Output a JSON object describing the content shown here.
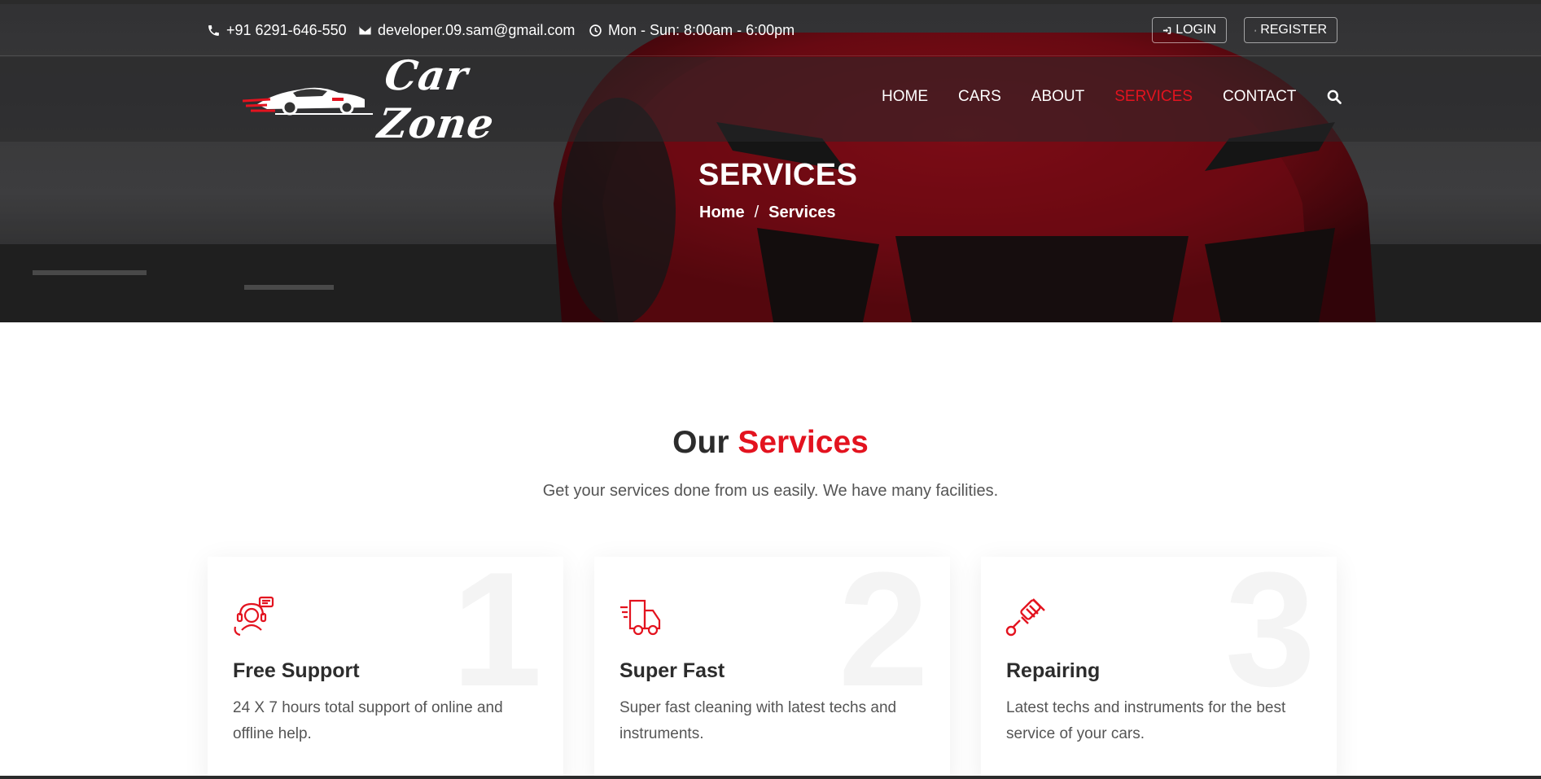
{
  "topbar": {
    "phone": "+91 6291-646-550",
    "email": "developer.09.sam@gmail.com",
    "hours": "Mon - Sun: 8:00am - 6:00pm",
    "login_label": "LOGIN",
    "register_label": "REGISTER"
  },
  "brand": {
    "name": "Car Zone"
  },
  "nav": {
    "items": [
      {
        "label": "HOME"
      },
      {
        "label": "CARS"
      },
      {
        "label": "ABOUT"
      },
      {
        "label": "SERVICES",
        "active": true
      },
      {
        "label": "CONTACT"
      }
    ],
    "search_icon": "search-icon"
  },
  "hero": {
    "title": "SERVICES",
    "breadcrumb": {
      "home": "Home",
      "separator": "/",
      "current": "Services"
    }
  },
  "services": {
    "heading_plain": "Our",
    "heading_accent": "Services",
    "subheading": "Get your services done from us easily. We have many facilities.",
    "cards": [
      {
        "number": "1",
        "icon": "support-agent-icon",
        "title": "Free Support",
        "description": "24 X 7 hours total support of online and offline help."
      },
      {
        "number": "2",
        "icon": "delivery-truck-icon",
        "title": "Super Fast",
        "description": "Super fast cleaning with latest techs and instruments."
      },
      {
        "number": "3",
        "icon": "spark-plug-icon",
        "title": "Repairing",
        "description": "Latest techs and instruments for the best service of your cars."
      }
    ]
  },
  "colors": {
    "accent": "#e3131f",
    "text_dark": "#2c2c2c",
    "text_muted": "#555555"
  }
}
